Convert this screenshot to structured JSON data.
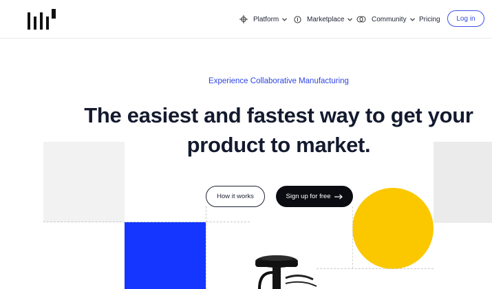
{
  "header": {
    "logo": "logo-mark",
    "nav": [
      {
        "label": "Platform",
        "icon": "crosshair-icon",
        "has_dropdown": true
      },
      {
        "label": "Marketplace",
        "icon": "coin-icon",
        "has_dropdown": true
      },
      {
        "label": "Community",
        "icon": "link-rings-icon",
        "has_dropdown": true
      },
      {
        "label": "Pricing",
        "has_dropdown": false
      }
    ],
    "login_label": "Log in"
  },
  "hero": {
    "eyebrow": "Experience Collaborative Manufacturing",
    "headline_line1": "The easiest and fastest way to get your",
    "headline_line2": "product to market.",
    "secondary_cta": "How it works",
    "primary_cta": "Sign up for free",
    "primary_cta_icon": "arrow-right-icon"
  },
  "colors": {
    "accent_blue": "#2f45e0",
    "block_blue": "#1436ff",
    "yellow": "#fbc800",
    "dark": "#0b0b12"
  }
}
